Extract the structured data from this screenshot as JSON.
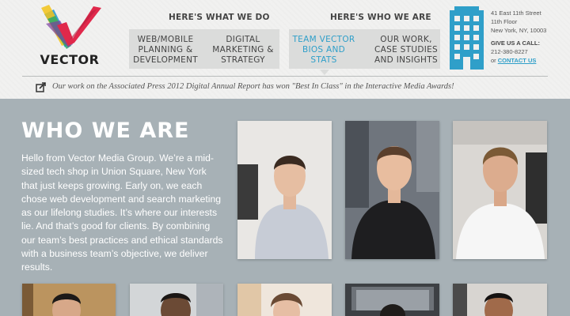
{
  "brand": {
    "name": "VECTOR",
    "logo_icon": "vector-v-logo-icon",
    "colors": [
      "#e0284b",
      "#f2c319",
      "#3aa6d8",
      "#28a96b",
      "#7b3fa0"
    ]
  },
  "nav": {
    "groups": [
      {
        "title": "HERE'S WHAT WE DO",
        "items": [
          {
            "label": "WEB/MOBILE PLANNING & DEVELOPMENT"
          },
          {
            "label": "DIGITAL MARKETING & STRATEGY"
          }
        ]
      },
      {
        "title": "HERE'S WHO WE ARE",
        "items": [
          {
            "label": "TEAM VECTOR BIOS AND STATS",
            "active": true
          },
          {
            "label": "OUR WORK, CASE STUDIES AND INSIGHTS"
          }
        ]
      }
    ]
  },
  "contact": {
    "address_line1": "41 East 11th Street",
    "address_line2": "11th Floor",
    "address_line3": "New York, NY, 10003",
    "call_label": "GIVE US A CALL:",
    "phone": "212-380-8227",
    "or": "or",
    "contact_link": "CONTACT US",
    "icon": "building-icon"
  },
  "news": {
    "icon": "share-icon",
    "text": "Our work on the Associated Press 2012 Digital Annual Report has won \"Best In Class\" in the Interactive Media Awards!"
  },
  "main": {
    "title": "WHO WE ARE",
    "intro": "Hello from Vector Media Group. We’re a mid-sized tech shop in Union Square, New York that just keeps growing. Early on, we each chose web development and search marketing as our lifelong studies. It’s where our interests lie. And that’s good for clients. By combining our team’s best practices and ethical standards with a business team’s objective, we deliver results."
  },
  "team_photos": [
    {
      "name": "team-photo-1"
    },
    {
      "name": "team-photo-2"
    },
    {
      "name": "team-photo-3"
    },
    {
      "name": "team-photo-4"
    },
    {
      "name": "team-photo-5"
    },
    {
      "name": "team-photo-6"
    },
    {
      "name": "team-photo-7"
    },
    {
      "name": "team-photo-8"
    }
  ],
  "colors": {
    "accent": "#2f9fc9",
    "background": "#a7b1b6",
    "header": "#f1f1f0",
    "nav_box": "#dbdcdb"
  }
}
